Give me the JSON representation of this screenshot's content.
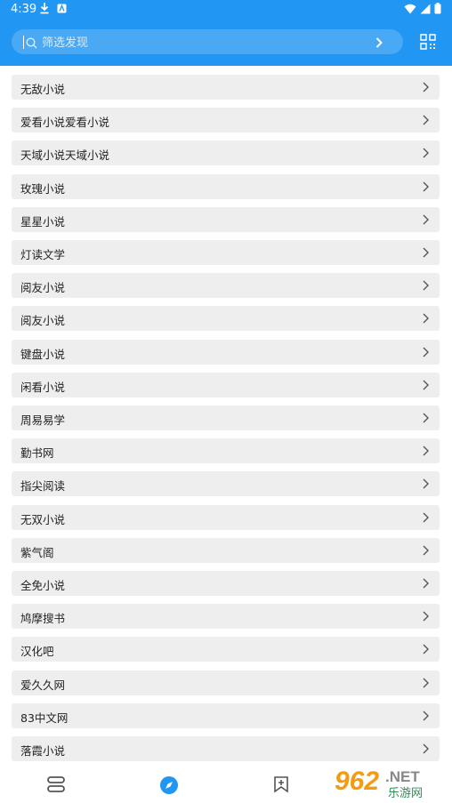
{
  "status_bar": {
    "time": "4:39"
  },
  "search": {
    "placeholder": "筛选发现"
  },
  "list": {
    "items": [
      "无敌小说",
      "爱看小说爱看小说",
      "天域小说天域小说",
      "玫瑰小说",
      "星星小说",
      "灯读文学",
      "阅友小说",
      "阅友小说",
      "键盘小说",
      "闲看小说",
      "周易易学",
      "勤书网",
      "指尖阅读",
      "无双小说",
      "紫气阁",
      "全免小说",
      "鸠摩搜书",
      "汉化吧",
      "爱久久网",
      "83中文网",
      "落霞小说"
    ]
  },
  "bottom_nav": {
    "active": "discover"
  },
  "watermark": {
    "number": "962",
    "suffix": ".NET",
    "sub": "乐游网"
  },
  "colors": {
    "primary": "#2196f3",
    "row_bg": "#eeeeee"
  }
}
